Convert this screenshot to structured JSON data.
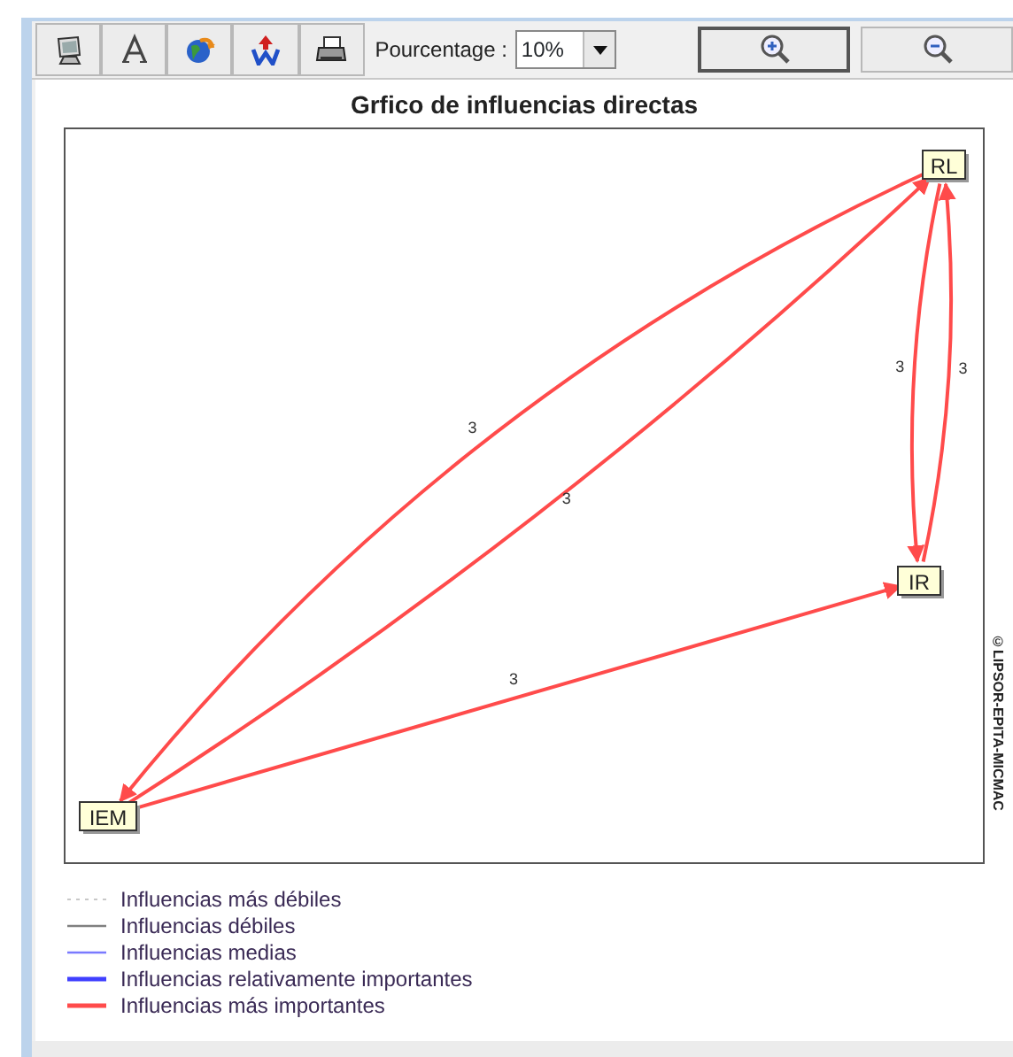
{
  "toolbar": {
    "tools": [
      {
        "kind": "monitor"
      },
      {
        "kind": "font"
      },
      {
        "kind": "globe"
      },
      {
        "kind": "export"
      },
      {
        "kind": "printer"
      }
    ],
    "percentage_label": "Pourcentage :",
    "percentage_value": "10%",
    "zoom_buttons": [
      {
        "kind": "zoom-in",
        "selected": true
      },
      {
        "kind": "zoom-out",
        "selected": false
      }
    ]
  },
  "graph": {
    "title": "Grfico de influencias directas",
    "nodes": [
      {
        "label": "RL"
      },
      {
        "label": "IR"
      },
      {
        "label": "IEM"
      }
    ],
    "edges": [
      {
        "label": "3"
      },
      {
        "label": "3"
      },
      {
        "label": "3"
      },
      {
        "label": "3"
      },
      {
        "label": "3"
      }
    ],
    "copyright": "©LIPSOR-EPITA-MICMAC"
  },
  "legend": [
    {
      "label": "Influencias más débiles",
      "kind": "dotted",
      "color": "#c8c8c8"
    },
    {
      "label": "Influencias débiles",
      "kind": "thin",
      "color": "#808080"
    },
    {
      "label": "Influencias medias",
      "kind": "thin",
      "color": "#7a7aff"
    },
    {
      "label": "Influencias relativamente importantes",
      "kind": "thick",
      "color": "#4040ff"
    },
    {
      "label": "Influencias más importantes",
      "kind": "thick",
      "color": "#ff4b4b"
    }
  ]
}
